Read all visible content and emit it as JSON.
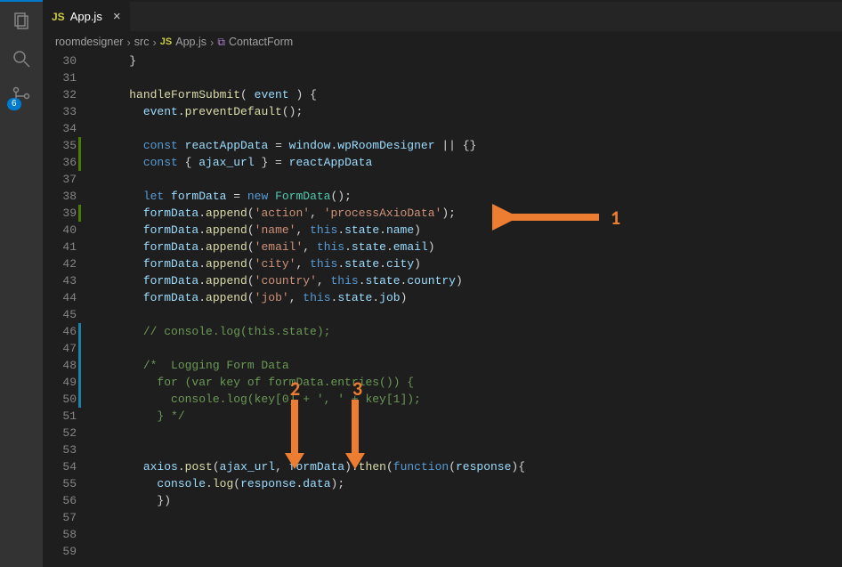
{
  "activity_bar": {
    "scm_badge": "6"
  },
  "tab": {
    "icon": "JS",
    "name": "App.js"
  },
  "breadcrumbs": {
    "parts": [
      "roomdesigner",
      "src",
      "App.js",
      "ContactForm"
    ],
    "js_icon": "JS"
  },
  "gutter": {
    "start": 30,
    "end": 59,
    "modified_green": [
      35,
      36,
      39
    ],
    "modified_blue": [
      46,
      47,
      48,
      49,
      50
    ]
  },
  "code": {
    "lines": [
      {
        "n": 30,
        "seg": [
          [
            "pun",
            "    }"
          ]
        ]
      },
      {
        "n": 31,
        "seg": []
      },
      {
        "n": 32,
        "seg": [
          [
            "pun",
            "    "
          ],
          [
            "fn",
            "handleFormSubmit"
          ],
          [
            "pun",
            "( "
          ],
          [
            "var",
            "event"
          ],
          [
            "pun",
            " ) {"
          ]
        ]
      },
      {
        "n": 33,
        "seg": [
          [
            "pun",
            "      "
          ],
          [
            "var",
            "event"
          ],
          [
            "pun",
            "."
          ],
          [
            "fn",
            "preventDefault"
          ],
          [
            "pun",
            "();"
          ]
        ]
      },
      {
        "n": 34,
        "seg": []
      },
      {
        "n": 35,
        "seg": [
          [
            "pun",
            "      "
          ],
          [
            "kw",
            "const"
          ],
          [
            "pun",
            " "
          ],
          [
            "var",
            "reactAppData"
          ],
          [
            "pun",
            " = "
          ],
          [
            "var",
            "window"
          ],
          [
            "pun",
            "."
          ],
          [
            "var",
            "wpRoomDesigner"
          ],
          [
            "pun",
            " || {}"
          ]
        ]
      },
      {
        "n": 36,
        "seg": [
          [
            "pun",
            "      "
          ],
          [
            "kw",
            "const"
          ],
          [
            "pun",
            " { "
          ],
          [
            "var",
            "ajax_url"
          ],
          [
            "pun",
            " } = "
          ],
          [
            "var",
            "reactAppData"
          ]
        ]
      },
      {
        "n": 37,
        "seg": []
      },
      {
        "n": 38,
        "seg": [
          [
            "pun",
            "      "
          ],
          [
            "kw",
            "let"
          ],
          [
            "pun",
            " "
          ],
          [
            "var",
            "formData"
          ],
          [
            "pun",
            " = "
          ],
          [
            "kw",
            "new"
          ],
          [
            "pun",
            " "
          ],
          [
            "cls",
            "FormData"
          ],
          [
            "pun",
            "();"
          ]
        ]
      },
      {
        "n": 39,
        "seg": [
          [
            "pun",
            "      "
          ],
          [
            "var",
            "formData"
          ],
          [
            "pun",
            "."
          ],
          [
            "fn",
            "append"
          ],
          [
            "pun",
            "("
          ],
          [
            "str",
            "'action'"
          ],
          [
            "pun",
            ", "
          ],
          [
            "str",
            "'processAxioData'"
          ],
          [
            "pun",
            ");"
          ]
        ]
      },
      {
        "n": 40,
        "seg": [
          [
            "pun",
            "      "
          ],
          [
            "var",
            "formData"
          ],
          [
            "pun",
            "."
          ],
          [
            "fn",
            "append"
          ],
          [
            "pun",
            "("
          ],
          [
            "str",
            "'name'"
          ],
          [
            "pun",
            ", "
          ],
          [
            "kw",
            "this"
          ],
          [
            "pun",
            "."
          ],
          [
            "var",
            "state"
          ],
          [
            "pun",
            "."
          ],
          [
            "var",
            "name"
          ],
          [
            "pun",
            ")"
          ]
        ]
      },
      {
        "n": 41,
        "seg": [
          [
            "pun",
            "      "
          ],
          [
            "var",
            "formData"
          ],
          [
            "pun",
            "."
          ],
          [
            "fn",
            "append"
          ],
          [
            "pun",
            "("
          ],
          [
            "str",
            "'email'"
          ],
          [
            "pun",
            ", "
          ],
          [
            "kw",
            "this"
          ],
          [
            "pun",
            "."
          ],
          [
            "var",
            "state"
          ],
          [
            "pun",
            "."
          ],
          [
            "var",
            "email"
          ],
          [
            "pun",
            ")"
          ]
        ]
      },
      {
        "n": 42,
        "seg": [
          [
            "pun",
            "      "
          ],
          [
            "var",
            "formData"
          ],
          [
            "pun",
            "."
          ],
          [
            "fn",
            "append"
          ],
          [
            "pun",
            "("
          ],
          [
            "str",
            "'city'"
          ],
          [
            "pun",
            ", "
          ],
          [
            "kw",
            "this"
          ],
          [
            "pun",
            "."
          ],
          [
            "var",
            "state"
          ],
          [
            "pun",
            "."
          ],
          [
            "var",
            "city"
          ],
          [
            "pun",
            ")"
          ]
        ]
      },
      {
        "n": 43,
        "seg": [
          [
            "pun",
            "      "
          ],
          [
            "var",
            "formData"
          ],
          [
            "pun",
            "."
          ],
          [
            "fn",
            "append"
          ],
          [
            "pun",
            "("
          ],
          [
            "str",
            "'country'"
          ],
          [
            "pun",
            ", "
          ],
          [
            "kw",
            "this"
          ],
          [
            "pun",
            "."
          ],
          [
            "var",
            "state"
          ],
          [
            "pun",
            "."
          ],
          [
            "var",
            "country"
          ],
          [
            "pun",
            ")"
          ]
        ]
      },
      {
        "n": 44,
        "seg": [
          [
            "pun",
            "      "
          ],
          [
            "var",
            "formData"
          ],
          [
            "pun",
            "."
          ],
          [
            "fn",
            "append"
          ],
          [
            "pun",
            "("
          ],
          [
            "str",
            "'job'"
          ],
          [
            "pun",
            ", "
          ],
          [
            "kw",
            "this"
          ],
          [
            "pun",
            "."
          ],
          [
            "var",
            "state"
          ],
          [
            "pun",
            "."
          ],
          [
            "var",
            "job"
          ],
          [
            "pun",
            ")"
          ]
        ]
      },
      {
        "n": 45,
        "seg": []
      },
      {
        "n": 46,
        "seg": [
          [
            "pun",
            "      "
          ],
          [
            "com",
            "// console.log(this.state);"
          ]
        ]
      },
      {
        "n": 47,
        "seg": []
      },
      {
        "n": 48,
        "seg": [
          [
            "pun",
            "      "
          ],
          [
            "com",
            "/*  Logging Form Data"
          ]
        ]
      },
      {
        "n": 49,
        "seg": [
          [
            "pun",
            "      "
          ],
          [
            "com",
            "  for (var key of formData.entries()) {"
          ]
        ]
      },
      {
        "n": 50,
        "seg": [
          [
            "pun",
            "      "
          ],
          [
            "com",
            "    console.log(key[0] + ', ' + key[1]);"
          ]
        ]
      },
      {
        "n": 51,
        "seg": [
          [
            "pun",
            "      "
          ],
          [
            "com",
            "  } */"
          ]
        ]
      },
      {
        "n": 52,
        "seg": []
      },
      {
        "n": 53,
        "seg": []
      },
      {
        "n": 54,
        "seg": [
          [
            "pun",
            "      "
          ],
          [
            "var",
            "axios"
          ],
          [
            "pun",
            "."
          ],
          [
            "fn",
            "post"
          ],
          [
            "pun",
            "("
          ],
          [
            "var",
            "ajax_url"
          ],
          [
            "pun",
            ", "
          ],
          [
            "var",
            "formData"
          ],
          [
            "pun",
            ")."
          ],
          [
            "fn",
            "then"
          ],
          [
            "pun",
            "("
          ],
          [
            "kw",
            "function"
          ],
          [
            "pun",
            "("
          ],
          [
            "var",
            "response"
          ],
          [
            "pun",
            "){"
          ]
        ]
      },
      {
        "n": 55,
        "seg": [
          [
            "pun",
            "        "
          ],
          [
            "var",
            "console"
          ],
          [
            "pun",
            "."
          ],
          [
            "fn",
            "log"
          ],
          [
            "pun",
            "("
          ],
          [
            "var",
            "response"
          ],
          [
            "pun",
            "."
          ],
          [
            "var",
            "data"
          ],
          [
            "pun",
            ");"
          ]
        ]
      },
      {
        "n": 56,
        "seg": [
          [
            "pun",
            "        })"
          ]
        ]
      },
      {
        "n": 57,
        "seg": []
      },
      {
        "n": 58,
        "seg": []
      },
      {
        "n": 59,
        "seg": []
      }
    ]
  },
  "annotations": {
    "label1": "1",
    "label2": "2",
    "label3": "3"
  }
}
